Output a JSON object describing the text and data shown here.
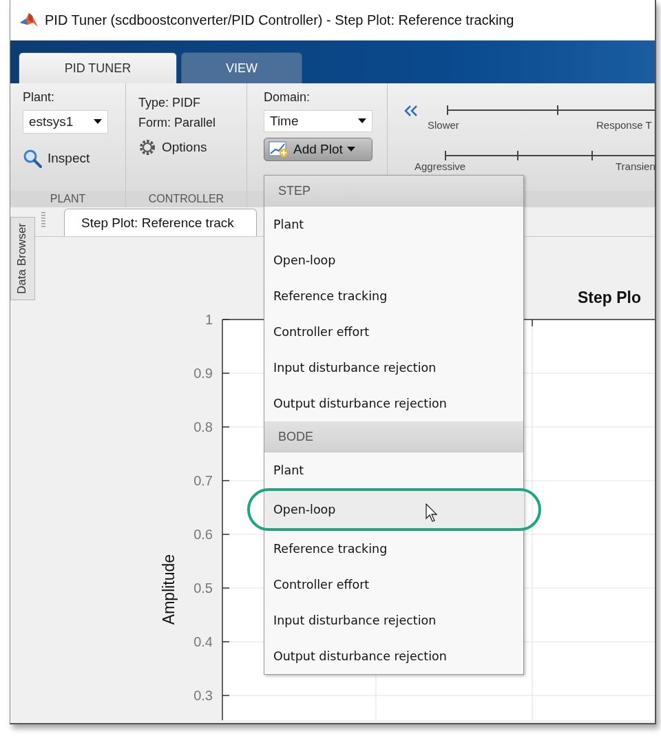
{
  "window": {
    "title": "PID Tuner (scdboostconverter/PID Controller) - Step Plot: Reference tracking"
  },
  "ribbon_tabs": [
    {
      "label": "PID TUNER",
      "selected": true
    },
    {
      "label": "VIEW",
      "selected": false
    }
  ],
  "toolstrip": {
    "plant": {
      "label": "Plant:",
      "value": "estsys1",
      "inspect": "Inspect",
      "section": "PLANT"
    },
    "controller": {
      "type": "Type: PIDF",
      "form": "Form: Parallel",
      "options": "Options",
      "section": "CONTROLLER"
    },
    "domain": {
      "label": "Domain:",
      "value": "Time",
      "add_plot": "Add Plot"
    },
    "sliders": [
      {
        "left_label": "Slower",
        "right_label": "Response T"
      },
      {
        "left_label": "Aggressive",
        "right_label": "Transien"
      }
    ]
  },
  "data_browser": {
    "label": "Data Browser"
  },
  "document_tabs": [
    {
      "label": "Step Plot: Reference track",
      "selected": true
    }
  ],
  "plot": {
    "title": "Step Plo",
    "ylabel": "Amplitude",
    "y_tick_labels": [
      "1",
      "0.9",
      "0.8",
      "0.7",
      "0.6",
      "0.5",
      "0.4",
      "0.3"
    ]
  },
  "add_plot_menu": {
    "sections": [
      {
        "header": "STEP",
        "items": [
          {
            "label": "Plant",
            "selected": false
          },
          {
            "label": "Open-loop",
            "selected": false
          },
          {
            "label": "Reference tracking",
            "selected": false
          },
          {
            "label": "Controller effort",
            "selected": false
          },
          {
            "label": "Input disturbance rejection",
            "selected": false
          },
          {
            "label": "Output disturbance rejection",
            "selected": false
          }
        ]
      },
      {
        "header": "BODE",
        "items": [
          {
            "label": "Plant",
            "selected": false
          },
          {
            "label": "Open-loop",
            "selected": true
          },
          {
            "label": "Reference tracking",
            "selected": false
          },
          {
            "label": "Controller effort",
            "selected": false
          },
          {
            "label": "Input disturbance rejection",
            "selected": false
          },
          {
            "label": "Output disturbance rejection",
            "selected": false
          }
        ]
      }
    ]
  }
}
